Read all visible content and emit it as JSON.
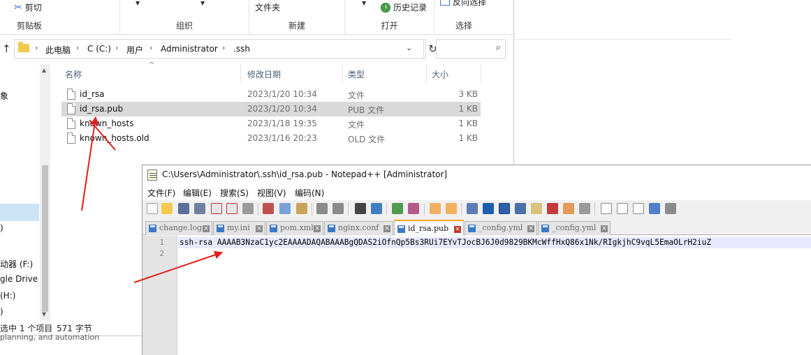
{
  "explorer": {
    "ribbon": {
      "cut_label": "剪切",
      "newfolder_label": "文件夹",
      "history_label": "历史记录",
      "invert_label": "反向选择",
      "groups": {
        "clipboard": "剪贴板",
        "organize": "组织",
        "new": "新建",
        "open": "打开",
        "select": "选择"
      }
    },
    "breadcrumb": [
      "此电脑",
      "C (C:)",
      "用户",
      "Administrator",
      ".ssh"
    ],
    "search_placeholder": "",
    "nav_items": [
      "象",
      "",
      "动器 (F:)",
      "gle Drive (",
      "(H:)",
      ")"
    ],
    "columns": {
      "name": "名称",
      "modified": "修改日期",
      "type": "类型",
      "size": "大小"
    },
    "files": [
      {
        "name": "id_rsa",
        "modified": "2023/1/20 10:34",
        "type": "文件",
        "size": "3 KB",
        "selected": false
      },
      {
        "name": "id_rsa.pub",
        "modified": "2023/1/20 10:34",
        "type": "PUB 文件",
        "size": "1 KB",
        "selected": true
      },
      {
        "name": "known_hosts",
        "modified": "2023/1/18 19:35",
        "type": "文件",
        "size": "1 KB",
        "selected": false
      },
      {
        "name": "known_hosts.old",
        "modified": "2023/1/16 20:23",
        "type": "OLD 文件",
        "size": "1 KB",
        "selected": false
      }
    ],
    "status": {
      "selected": "选中 1 个项目",
      "size": "571 字节"
    },
    "background_text": "planning, and automation"
  },
  "notepad": {
    "title": "C:\\Users\\Administrator\\.ssh\\id_rsa.pub - Notepad++ [Administrator]",
    "menu": [
      "文件(F)",
      "编辑(E)",
      "搜索(S)",
      "视图(V)",
      "编码(N)"
    ],
    "tabs": [
      "change.log",
      "my.ini",
      "pom.xml",
      "nginx.conf",
      "id_rsa.pub",
      "_config.yml",
      "_config.yml"
    ],
    "active_tab": 4,
    "line_numbers": [
      "1",
      "2"
    ],
    "line1": "ssh-rsa AAAAB3NzaC1yc2EAAAADAQABAAABgQDAS2iOfnQp5Bs3RUi7EYvTJocBJ6J0d9829BKMcWffHxQ86x1Nk/RIgkjhC9vqL5EmaOLrH2iuZ"
  },
  "colors": {
    "selection": "#d9d9d9",
    "nav_selection": "#cce4f7",
    "annotation_arrow": "#e0201b",
    "active_tab_accent": "#f5a623",
    "current_line": "#e8e8ff"
  }
}
